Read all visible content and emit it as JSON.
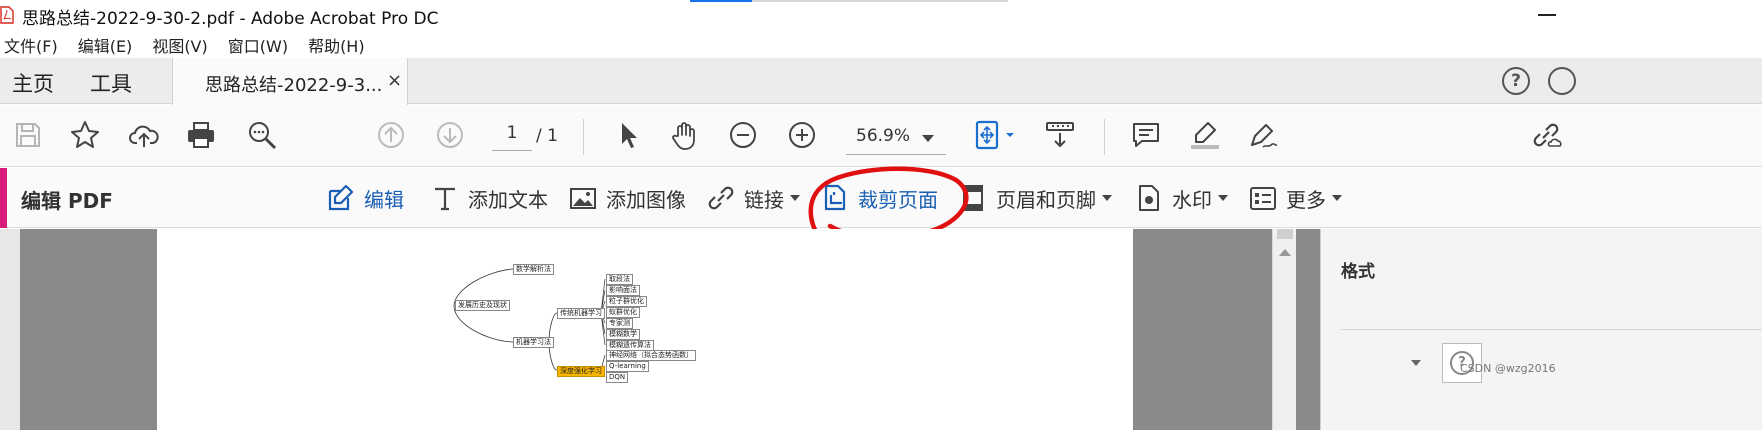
{
  "window": {
    "title": "思路总结-2022-9-30-2.pdf - Adobe Acrobat Pro DC"
  },
  "menu": {
    "items": [
      "文件(F)",
      "编辑(E)",
      "视图(V)",
      "窗口(W)",
      "帮助(H)"
    ]
  },
  "tabs": {
    "home": "主页",
    "tools": "工具",
    "document": "思路总结-2022-9-3...",
    "close_glyph": "×",
    "help_glyph": "?"
  },
  "toolbar": {
    "page_current": "1",
    "page_total": "/ 1",
    "zoom": "56.9%"
  },
  "edit_panel": {
    "title": "编辑 PDF",
    "tools": {
      "edit": "编辑",
      "add_text": "添加文本",
      "add_image": "添加图像",
      "link": "链接",
      "crop": "裁剪页面",
      "header_footer": "页眉和页脚",
      "watermark": "水印",
      "more": "更多"
    },
    "accent_color": "#d81b7a",
    "active_color": "#1a5fb4"
  },
  "mindmap": {
    "nodes": {
      "root": "发展历史及现状",
      "math": "数学解析法",
      "ml": "机器学习法",
      "traditional": "传统机器学习",
      "deep_rl": "深度强化学习",
      "t1": "取段法",
      "t2": "影响面法",
      "t3": "粒子群优化",
      "t4": "蚁群优化",
      "t5": "专家测",
      "t6": "模糊数学",
      "t7": "模糊遗传算法",
      "d1": "神经网络（拟合态势函数）",
      "d2": "Q-learning",
      "d3": "DQN"
    },
    "highlight_color": "#f7b500"
  },
  "right_panel": {
    "heading": "格式",
    "help_glyph": "?"
  },
  "watermark_text": "CSDN @wzg2016",
  "annotation": {
    "color": "#e01010"
  }
}
